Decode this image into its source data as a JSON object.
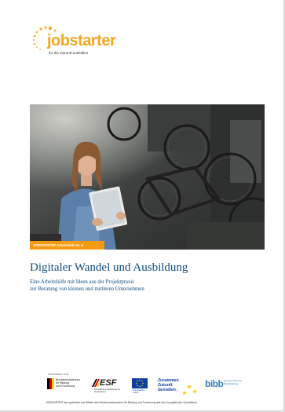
{
  "logo": {
    "word": "jobstarter",
    "tagline": "für die Zukunft ausbilden"
  },
  "cover": {
    "series_badge": "JOBSTARTER Arbeitshilfe Nr. 6",
    "title": "Digitaler Wandel und Ausbildung",
    "subtitle_lines": [
      "Eine Arbeitshilfe mit Ideen aus der Projektpraxis",
      "zur Beratung von kleinen und mittleren Unternehmen"
    ]
  },
  "footer": {
    "funded_by": "GEFÖRDERT VOM",
    "bmbf_lines": [
      "Bundesministerium",
      "für Bildung",
      "und Forschung"
    ],
    "esf_word": "ESF",
    "esf_small": "Europäischer Sozialfonds für Deutschland",
    "eu_lines": [
      "Europäische",
      "Union"
    ],
    "zusammen_lines": [
      "Zusammen.",
      "Zukunft.",
      "Gestalten."
    ],
    "bibb_word": "bibb",
    "bibb_sub": [
      "Bundesinstitut für",
      "Berufsbildung"
    ],
    "footnote": "JOBSTARTER wird gefördert aus Mitteln des Bundesministeriums für Bildung und Forschung und des Europäischen Sozialfonds."
  },
  "colors": {
    "accent_orange": "#f39c12",
    "title_blue": "#0f4c81"
  }
}
